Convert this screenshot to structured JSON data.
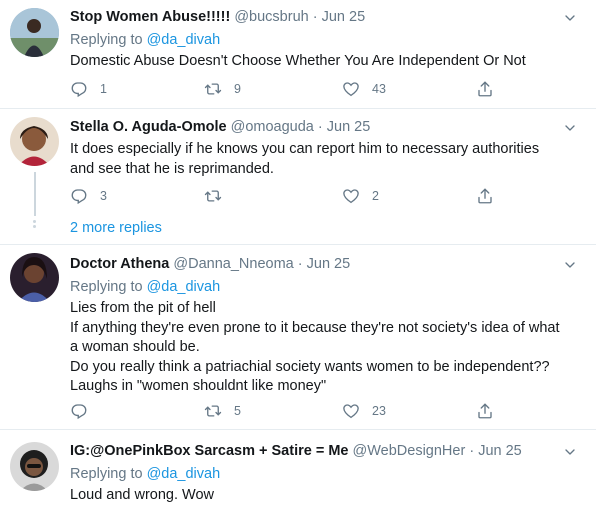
{
  "tweets": [
    {
      "name": "Stop Women Abuse!!!!!",
      "handle": "@bucsbruh",
      "sep": "·",
      "date": "Jun 25",
      "replying_prefix": "Replying to",
      "replying_to": "@da_divah",
      "text_lines": [
        "Domestic Abuse Doesn't Choose Whether You Are Independent Or Not"
      ],
      "replies": "1",
      "retweets": "9",
      "likes": "43"
    },
    {
      "name": "Stella O. Aguda-Omole",
      "handle": "@omoaguda",
      "sep": "·",
      "date": "Jun 25",
      "text_lines": [
        "It does especially if he knows you can report him to necessary authorities",
        "and see that he is reprimanded."
      ],
      "replies": "3",
      "retweets": "",
      "likes": "2"
    },
    {
      "name": "Doctor Athena",
      "handle": "@Danna_Nneoma",
      "sep": "·",
      "date": "Jun 25",
      "replying_prefix": "Replying to",
      "replying_to": "@da_divah",
      "text_lines": [
        "Lies from the pit of hell",
        "If anything they're even prone to it because they're not society's idea of what",
        "a woman should be.",
        "Do you really think a patriachial society wants women to be independent??",
        "Laughs in \"women shouldnt like money\""
      ],
      "replies": "",
      "retweets": "5",
      "likes": "23"
    },
    {
      "name": "IG:@OnePinkBox Sarcasm + Satire = Me",
      "handle": "@WebDesignHer",
      "sep": "·",
      "date": "Jun 25",
      "replying_prefix": "Replying to",
      "replying_to": "@da_divah",
      "text_lines": [
        "Loud and wrong. Wow"
      ]
    }
  ],
  "more_replies": "2 more replies",
  "icons": {
    "reply": "reply-icon",
    "retweet": "retweet-icon",
    "like": "heart-icon",
    "share": "share-icon",
    "more": "chevron-down-icon"
  },
  "colors": {
    "link": "#1b95e0",
    "muted": "#657786",
    "divider": "#e6ecf0"
  }
}
